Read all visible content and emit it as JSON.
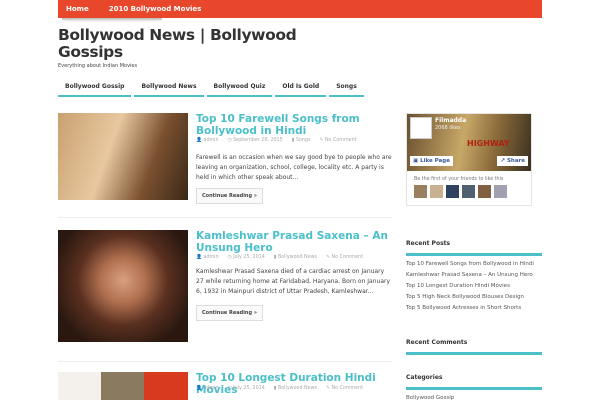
{
  "topnav": [
    "Home",
    "2010 Bollywood Movies"
  ],
  "site": {
    "title": "Bollywood News | Bollywood Gossips",
    "tagline": "Everything about Indian Movies"
  },
  "menu": [
    "Bollywood Gossip",
    "Bollywood News",
    "Bollywood Quiz",
    "Old Is Gold",
    "Songs"
  ],
  "posts": [
    {
      "title": "Top 10 Farewell Songs from Bollywood in Hindi",
      "author": "admin",
      "date": "September 28, 2015",
      "category": "Songs",
      "comments": "No Comment",
      "excerpt": "Farewell is an occasion when we say good bye to people who are leaving an organization, school, college, locality etc. A party is held in which other speak about...",
      "more": "Continue Reading »"
    },
    {
      "title": "Kamleshwar Prasad Saxena – An Unsung Hero",
      "author": "admin",
      "date": "July 25, 2014",
      "category": "Bollywood News",
      "comments": "No Comment",
      "excerpt": "Kamleshwar Prasad Saxena died of a cardiac arrest on January 27 while returning home at Faridabad, Haryana. Born on January 6, 1932 in Mainpuri district of Uttar Pradesh, Kamleshwar...",
      "more": "Continue Reading »"
    },
    {
      "title": "Top 10 Longest Duration Hindi Movies",
      "author": "admin",
      "date": "July 25, 2014",
      "category": "Bollywood News",
      "comments": "No Comment"
    }
  ],
  "facebook": {
    "page": "Filmadda",
    "likes": "2068 likes",
    "like_btn": "Like Page",
    "share_btn": "Share",
    "friends": "Be the first of your friends to like this",
    "cover_text": "HIGHWAY"
  },
  "sidebar": {
    "recent_posts_title": "Recent Posts",
    "recent_posts": [
      "Top 10 Farewell Songs from Bollywood in Hindi",
      "Kamleshwar Prasad Saxena – An Unsung Hero",
      "Top 10 Longest Duration Hindi Movies",
      "Top 5 High Neck Bollywood Blouses Design",
      "Top 5 Bollywood Actresses in Short Shorts"
    ],
    "recent_comments_title": "Recent Comments",
    "categories_title": "Categories",
    "categories": [
      "Bollywood Gossip"
    ]
  }
}
